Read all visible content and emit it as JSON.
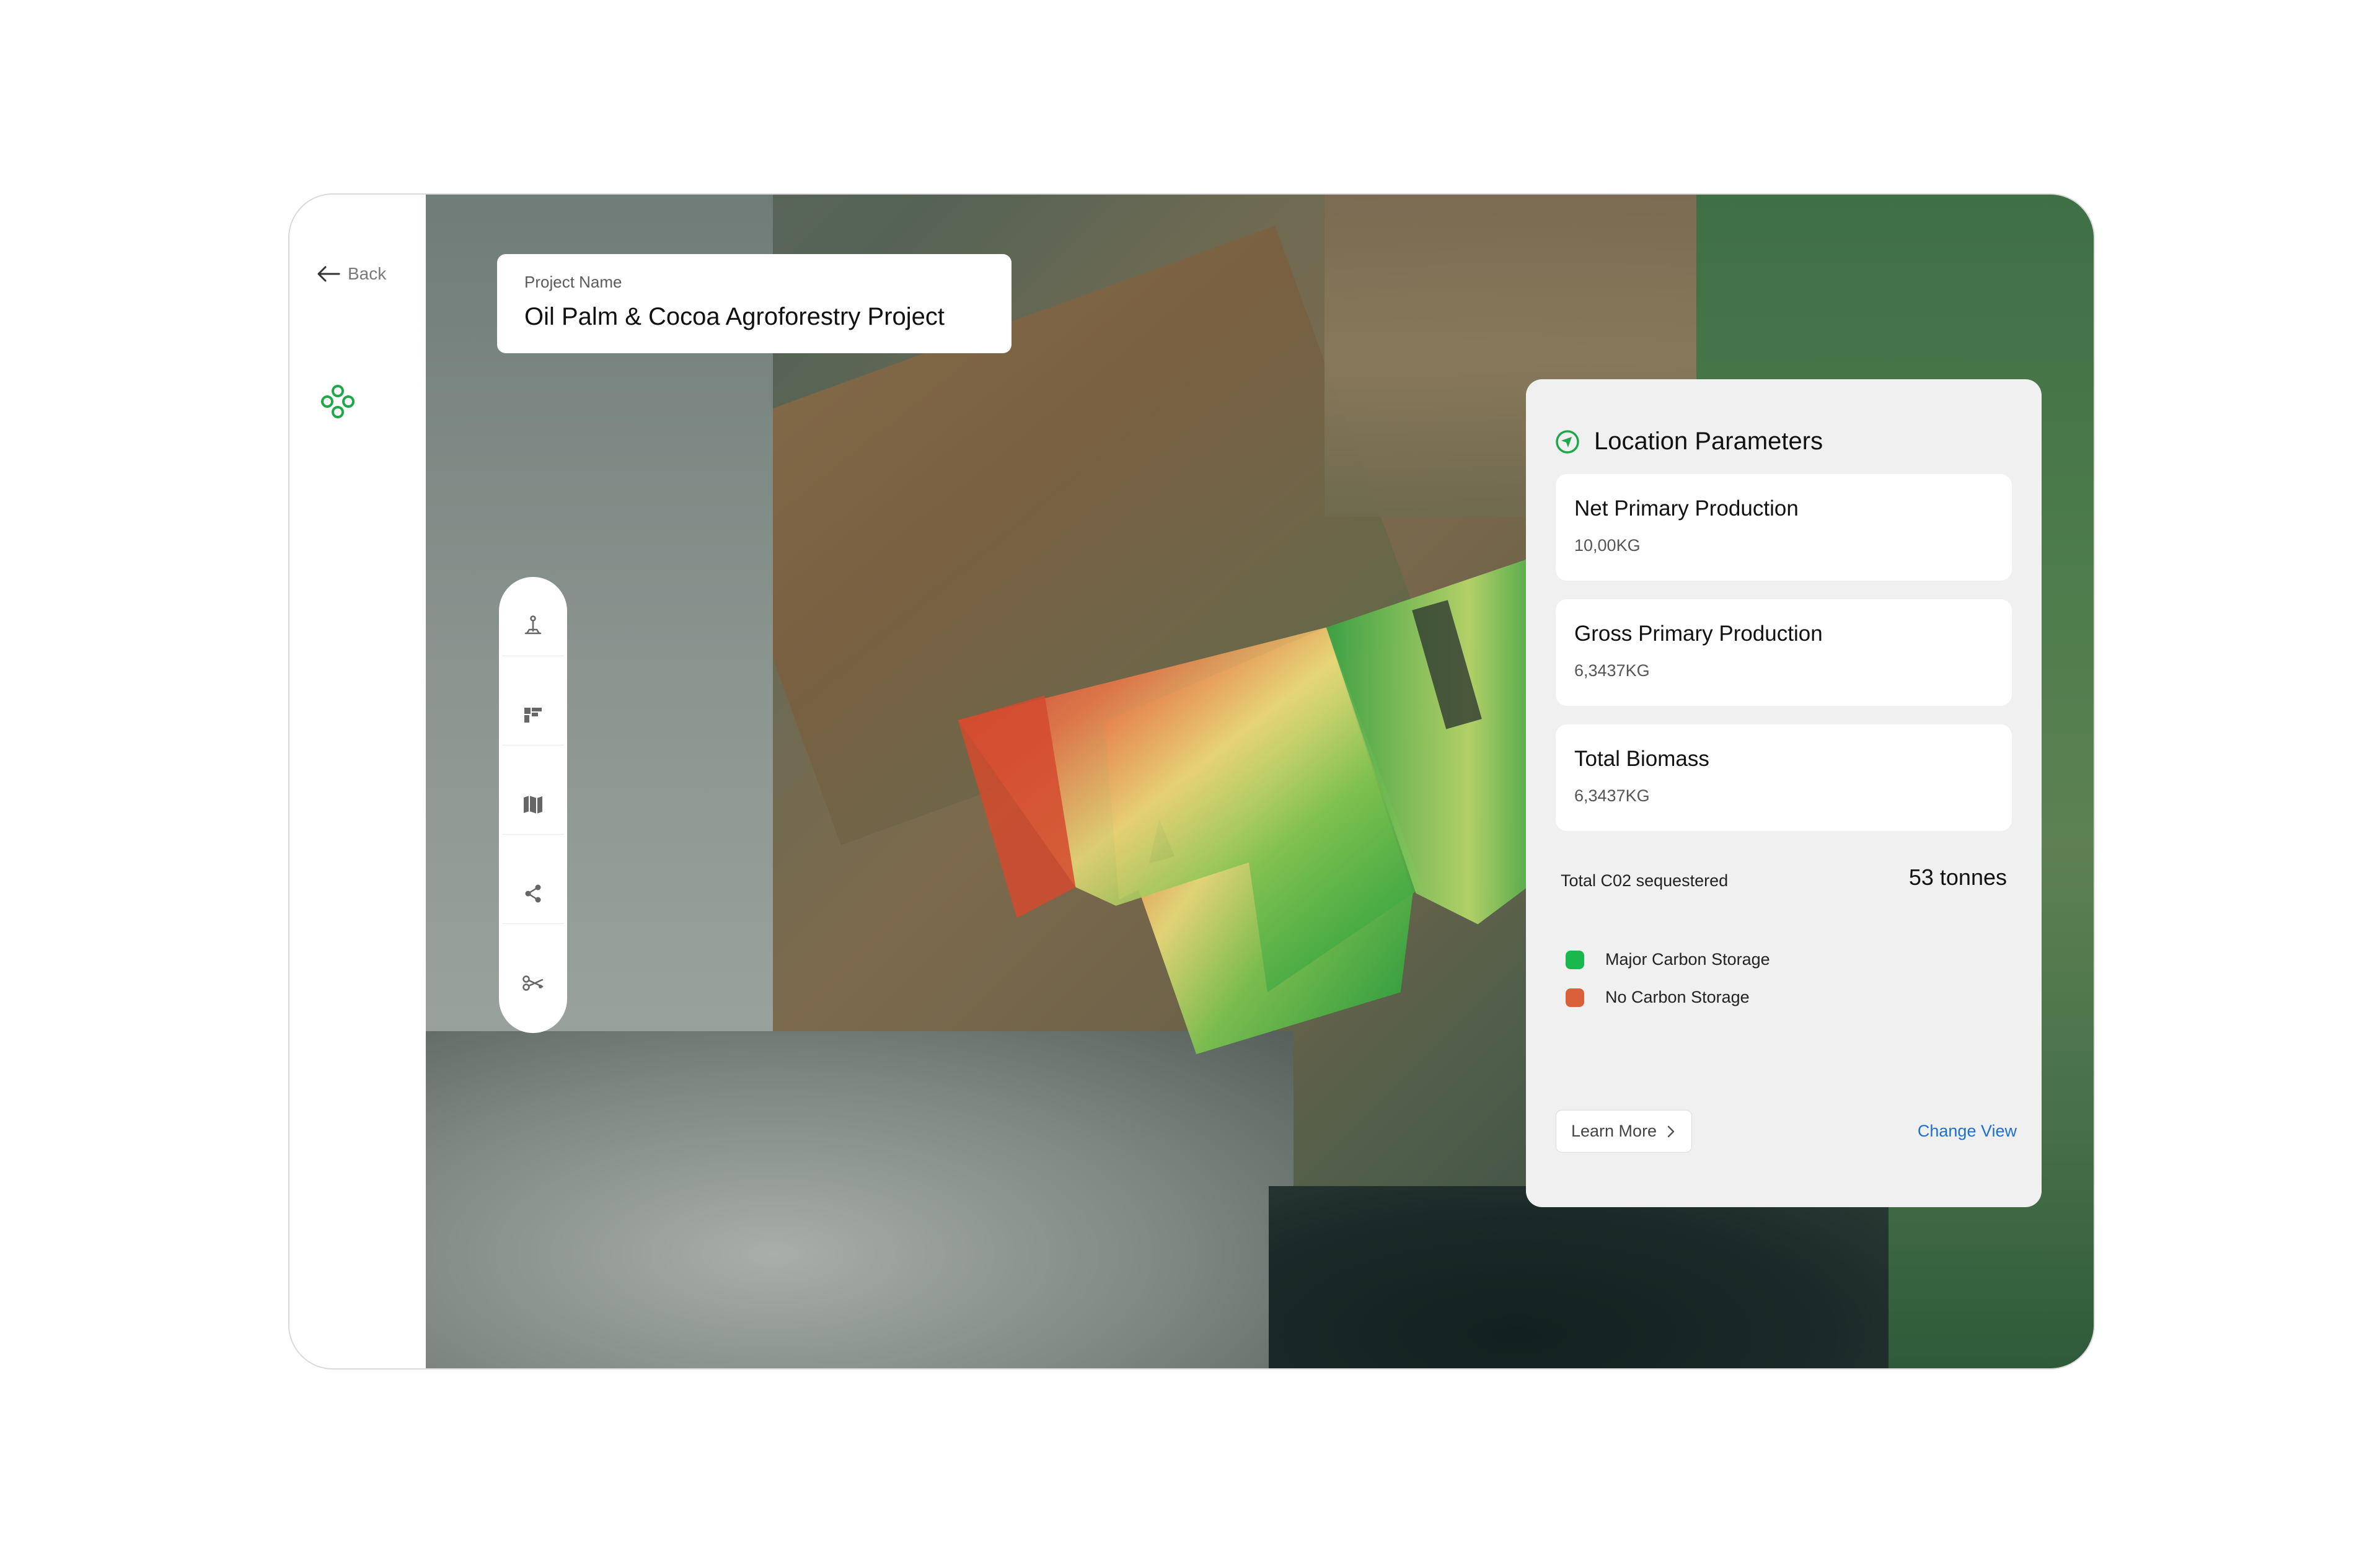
{
  "sidebar": {
    "back_label": "Back",
    "logo_icon": "clover-logo-icon",
    "accent": "#1fa84a"
  },
  "project": {
    "label": "Project Name",
    "name": "Oil Palm & Cocoa Agroforestry Project"
  },
  "toolbar": {
    "tools": [
      {
        "icon": "joystick-icon"
      },
      {
        "icon": "grid-icon"
      },
      {
        "icon": "map-icon"
      },
      {
        "icon": "share-icon"
      },
      {
        "icon": "scissors-icon"
      }
    ]
  },
  "panel": {
    "title": "Location Parameters",
    "title_icon": "navigation-circle-icon",
    "metrics": [
      {
        "name": "Net Primary Production",
        "value": "10,00KG"
      },
      {
        "name": "Gross Primary Production",
        "value": "6,3437KG"
      },
      {
        "name": "Total Biomass",
        "value": "6,3437KG"
      }
    ],
    "co2_label": "Total C02 sequestered",
    "co2_value": "53 tonnes",
    "legend": [
      {
        "label": "Major Carbon Storage",
        "color": "#19b84c"
      },
      {
        "label": "No Carbon Storage",
        "color": "#d9603a"
      }
    ],
    "learn_more": "Learn More",
    "change_view": "Change View"
  }
}
